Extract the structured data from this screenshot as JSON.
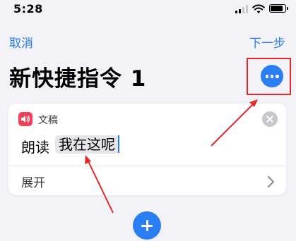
{
  "status_bar": {
    "time": "5:28",
    "signal_icon": "cellular-signal-icon",
    "wifi_icon": "wifi-icon",
    "battery_icon": "battery-icon"
  },
  "nav": {
    "cancel_label": "取消",
    "next_label": "下一步"
  },
  "title": "新快捷指令 1",
  "more_icon": "ellipsis-icon",
  "action_card": {
    "app_name": "文稿",
    "app_icon": "speaker-icon",
    "action_label": "朗读",
    "text_param": "我在这呢",
    "expand_label": "展开",
    "clear_icon": "close-icon",
    "expand_icon": "chevron-right-icon"
  },
  "add_icon": "plus-icon",
  "colors": {
    "accent": "#2a7ef3",
    "annotation": "#e12a2a",
    "app_icon": "#f2405a",
    "background": "#f2f2f7"
  }
}
